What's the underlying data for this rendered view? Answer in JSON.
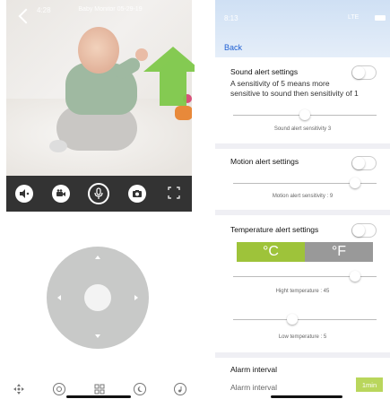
{
  "left_panel": {
    "video": {
      "status_time": "4:28",
      "camera_title": "Baby Monitor 05-29-19",
      "camera_subtitle": "",
      "status_icons": "",
      "bottom_left_text": "",
      "bottom_right_text": ""
    },
    "controls": [
      {
        "name": "speaker-icon",
        "glyph": "◀"
      },
      {
        "name": "record-icon",
        "glyph": "●"
      },
      {
        "name": "microphone-icon",
        "glyph": "🎤"
      },
      {
        "name": "camera-icon",
        "glyph": "📷"
      },
      {
        "name": "fullscreen-icon",
        "glyph": "⤢"
      }
    ],
    "bottom_tabs": [
      {
        "name": "pan-tilt-tab-icon",
        "glyph": "✥"
      },
      {
        "name": "music-tab-icon",
        "glyph": "♫"
      },
      {
        "name": "settings-grid-tab-icon",
        "glyph": "▦"
      },
      {
        "name": "night-mode-tab-icon",
        "glyph": "☾"
      },
      {
        "name": "lullaby-tab-icon",
        "glyph": "♪"
      }
    ],
    "arrow_color": "#7ec84a"
  },
  "right_panel": {
    "status_time": "8:13",
    "status_signal": "LTE",
    "back_label": "Back",
    "sound": {
      "title": "Sound alert settings",
      "description_line1": "A sensitivity of 5 means more",
      "description_line2": "sensitive to sound then sensitivity of 1",
      "slider_label": "Sound alert sensitivity  3",
      "slider_value": 3,
      "slider_max": 5
    },
    "motion": {
      "title": "Motion alert settings",
      "slider_label": "Motion alert sensitivity : 9",
      "slider_value": 9,
      "slider_max": 10
    },
    "temperature": {
      "title": "Temperature alert settings",
      "unit_c": "°C",
      "unit_f": "°F",
      "high_label": "Hight temperature :  45",
      "high_fraction": 0.92,
      "low_label": "Low temperature :  5",
      "low_fraction": 0.4
    },
    "alarm": {
      "title": "Alarm interval",
      "label": "Alarm interval",
      "button": "1min"
    },
    "accent_green": "#9ec33a",
    "link_blue": "#1f5fd3"
  }
}
